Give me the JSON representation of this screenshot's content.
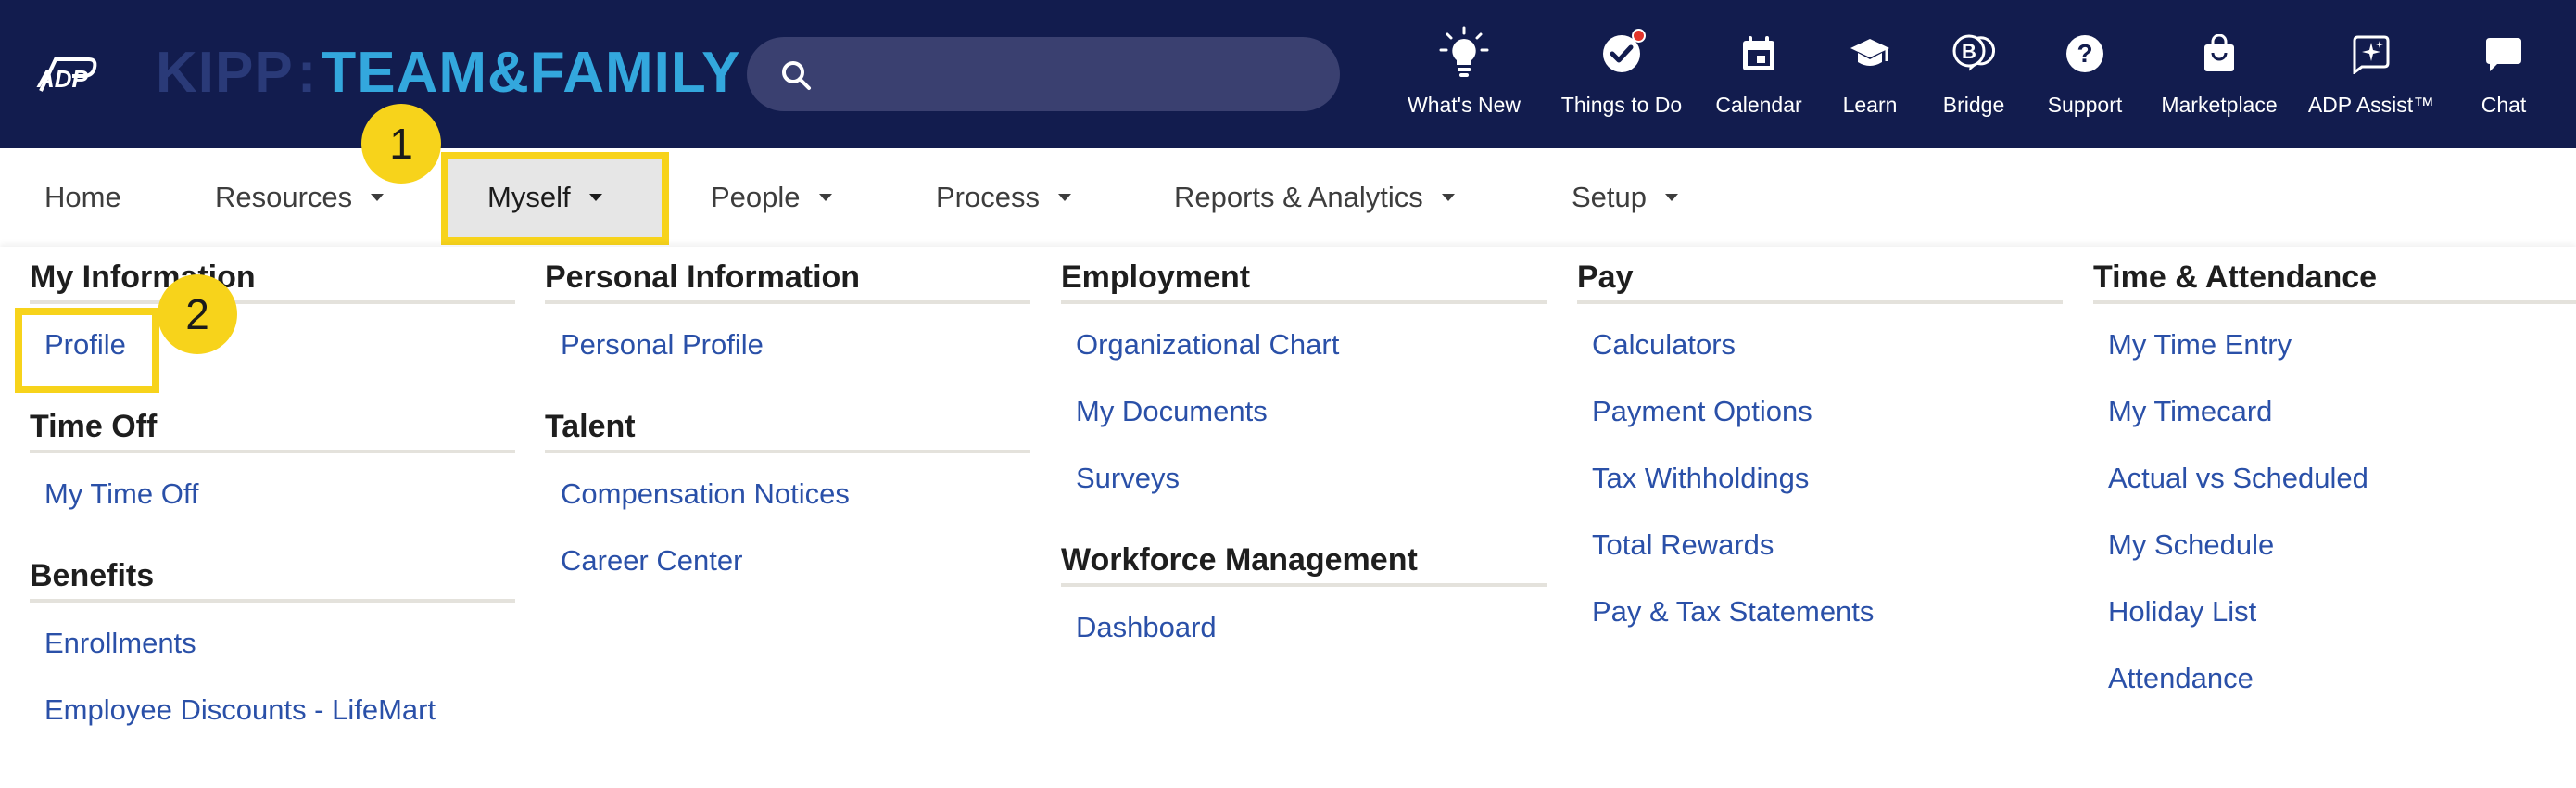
{
  "header": {
    "adp_logo": "ADP",
    "brand_part1": "KIPP",
    "brand_colon": ":",
    "brand_part2": "TEAM&FAMILY",
    "search_placeholder": "",
    "items": [
      {
        "label": "What's New",
        "icon": "lightbulb-icon"
      },
      {
        "label": "Things to Do",
        "icon": "checkmark-circle-icon",
        "has_notification": true
      },
      {
        "label": "Calendar",
        "icon": "calendar-icon"
      },
      {
        "label": "Learn",
        "icon": "graduation-cap-icon"
      },
      {
        "label": "Bridge",
        "icon": "bridge-chat-icon"
      },
      {
        "label": "Support",
        "icon": "question-circle-icon"
      },
      {
        "label": "Marketplace",
        "icon": "shopping-bag-icon"
      },
      {
        "label": "ADP Assist™",
        "icon": "sparkle-chat-icon"
      },
      {
        "label": "Chat",
        "icon": "chat-bubble-icon"
      }
    ]
  },
  "nav": {
    "items": [
      {
        "label": "Home"
      },
      {
        "label": "Resources"
      },
      {
        "label": "Myself"
      },
      {
        "label": "People"
      },
      {
        "label": "Process"
      },
      {
        "label": "Reports & Analytics"
      },
      {
        "label": "Setup"
      }
    ]
  },
  "menu": {
    "my_information": {
      "title": "My Information",
      "links": [
        "Profile"
      ]
    },
    "time_off": {
      "title": "Time Off",
      "links": [
        "My Time Off"
      ]
    },
    "benefits": {
      "title": "Benefits",
      "links": [
        "Enrollments",
        "Employee Discounts - LifeMart"
      ]
    },
    "personal_information": {
      "title": "Personal Information",
      "links": [
        "Personal Profile"
      ]
    },
    "talent": {
      "title": "Talent",
      "links": [
        "Compensation Notices",
        "Career Center"
      ]
    },
    "employment": {
      "title": "Employment",
      "links": [
        "Organizational Chart",
        "My Documents",
        "Surveys"
      ]
    },
    "workforce_management": {
      "title": "Workforce Management",
      "links": [
        "Dashboard"
      ]
    },
    "pay": {
      "title": "Pay",
      "links": [
        "Calculators",
        "Payment Options",
        "Tax Withholdings",
        "Total Rewards",
        "Pay & Tax Statements"
      ]
    },
    "time_attendance": {
      "title": "Time & Attendance",
      "links": [
        "My Time Entry",
        "My Timecard",
        "Actual vs Scheduled",
        "My Schedule",
        "Holiday List",
        "Attendance"
      ]
    }
  },
  "annotations": {
    "step1": "1",
    "step2": "2"
  },
  "colors": {
    "header_bg": "#121c4e",
    "brand_blue": "#33a7dd",
    "link_blue": "#2a50a8",
    "highlight_yellow": "#f7d31b",
    "notification_red": "#e2352b"
  }
}
